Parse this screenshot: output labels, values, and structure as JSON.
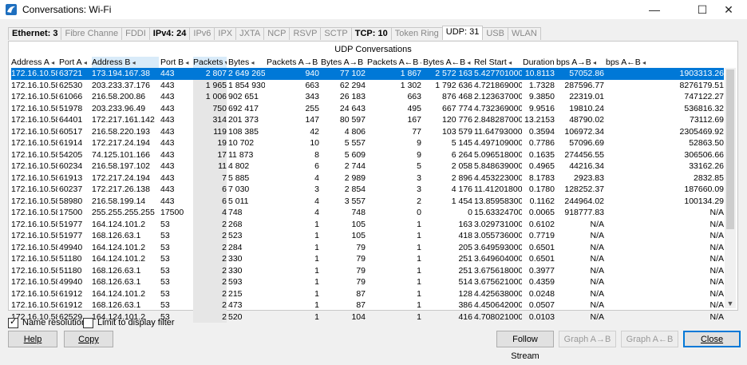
{
  "window": {
    "title": "Conversations: Wi-Fi",
    "minimize": "—",
    "maximize": "☐",
    "close": "✕"
  },
  "tabs": [
    {
      "label": "Ethernet: 3",
      "style": "bold"
    },
    {
      "label": "Fibre Channe",
      "style": "dim"
    },
    {
      "label": "FDDI",
      "style": "dim"
    },
    {
      "label": "IPv4: 24",
      "style": "bold"
    },
    {
      "label": "IPv6",
      "style": "dim"
    },
    {
      "label": "IPX",
      "style": "dim"
    },
    {
      "label": "JXTA",
      "style": "dim"
    },
    {
      "label": "NCP",
      "style": "dim"
    },
    {
      "label": "RSVP",
      "style": "dim"
    },
    {
      "label": "SCTP",
      "style": "dim"
    },
    {
      "label": "TCP: 10",
      "style": "bold"
    },
    {
      "label": "Token Ring",
      "style": "dim"
    },
    {
      "label": "UDP: 31",
      "style": "active"
    },
    {
      "label": "USB",
      "style": "dim"
    },
    {
      "label": "WLAN",
      "style": "dim"
    }
  ],
  "panel_title": "UDP Conversations",
  "columns": [
    "Address A",
    "Port A",
    "Address B",
    "Port B",
    "Packets",
    "Bytes",
    "Packets A→B",
    "Bytes A→B",
    "Packets A←B",
    "Bytes A←B",
    "Rel Start",
    "Duration",
    "bps A→B",
    "bps A←B"
  ],
  "sort_column": "Packets",
  "rows": [
    [
      "172.16.10.58",
      "63721",
      "173.194.167.38",
      "443",
      "2 807",
      "2 649 265",
      "940",
      "77 102",
      "1 867",
      "2 572 163",
      "5.427701000",
      "10.8113",
      "57052.86",
      "1903313.26"
    ],
    [
      "172.16.10.58",
      "62530",
      "203.233.37.176",
      "443",
      "1 965",
      "1 854 930",
      "663",
      "62 294",
      "1 302",
      "1 792 636",
      "4.721869000",
      "1.7328",
      "287596.77",
      "8276179.51"
    ],
    [
      "172.16.10.58",
      "61066",
      "216.58.200.86",
      "443",
      "1 006",
      "902 651",
      "343",
      "26 183",
      "663",
      "876 468",
      "2.123637000",
      "9.3850",
      "22319.01",
      "747122.27"
    ],
    [
      "172.16.10.58",
      "51978",
      "203.233.96.49",
      "443",
      "750",
      "692 417",
      "255",
      "24 643",
      "495",
      "667 774",
      "4.732369000",
      "9.9516",
      "19810.24",
      "536816.32"
    ],
    [
      "172.16.10.58",
      "64401",
      "172.217.161.142",
      "443",
      "314",
      "201 373",
      "147",
      "80 597",
      "167",
      "120 776",
      "2.848287000",
      "13.2153",
      "48790.02",
      "73112.69"
    ],
    [
      "172.16.10.58",
      "60517",
      "216.58.220.193",
      "443",
      "119",
      "108 385",
      "42",
      "4 806",
      "77",
      "103 579",
      "11.647930000",
      "0.3594",
      "106972.34",
      "2305469.92"
    ],
    [
      "172.16.10.58",
      "61914",
      "172.217.24.194",
      "443",
      "19",
      "10 702",
      "10",
      "5 557",
      "9",
      "5 145",
      "4.497109000",
      "0.7786",
      "57096.69",
      "52863.50"
    ],
    [
      "172.16.10.58",
      "54205",
      "74.125.101.166",
      "443",
      "17",
      "11 873",
      "8",
      "5 609",
      "9",
      "6 264",
      "5.096518000",
      "0.1635",
      "274456.55",
      "306506.66"
    ],
    [
      "172.16.10.58",
      "60234",
      "216.58.197.102",
      "443",
      "11",
      "4 802",
      "6",
      "2 744",
      "5",
      "2 058",
      "5.848639000",
      "0.4965",
      "44216.34",
      "33162.26"
    ],
    [
      "172.16.10.58",
      "61913",
      "172.217.24.194",
      "443",
      "7",
      "5 885",
      "4",
      "2 989",
      "3",
      "2 896",
      "4.453223000",
      "8.1783",
      "2923.83",
      "2832.85"
    ],
    [
      "172.16.10.58",
      "60237",
      "172.217.26.138",
      "443",
      "6",
      "7 030",
      "3",
      "2 854",
      "3",
      "4 176",
      "11.412018000",
      "0.1780",
      "128252.37",
      "187660.09"
    ],
    [
      "172.16.10.58",
      "58980",
      "216.58.199.14",
      "443",
      "6",
      "5 011",
      "4",
      "3 557",
      "2",
      "1 454",
      "13.859583000",
      "0.1162",
      "244964.02",
      "100134.29"
    ],
    [
      "172.16.10.58",
      "17500",
      "255.255.255.255",
      "17500",
      "4",
      "748",
      "4",
      "748",
      "0",
      "0",
      "15.633247000",
      "0.0065",
      "918777.83",
      "N/A"
    ],
    [
      "172.16.10.58",
      "51977",
      "164.124.101.2",
      "53",
      "2",
      "268",
      "1",
      "105",
      "1",
      "163",
      "3.029731000",
      "0.6102",
      "N/A",
      "N/A"
    ],
    [
      "172.16.10.58",
      "51977",
      "168.126.63.1",
      "53",
      "2",
      "523",
      "1",
      "105",
      "1",
      "418",
      "3.055736000",
      "0.7719",
      "N/A",
      "N/A"
    ],
    [
      "172.16.10.58",
      "49940",
      "164.124.101.2",
      "53",
      "2",
      "284",
      "1",
      "79",
      "1",
      "205",
      "3.649593000",
      "0.6501",
      "N/A",
      "N/A"
    ],
    [
      "172.16.10.58",
      "51180",
      "164.124.101.2",
      "53",
      "2",
      "330",
      "1",
      "79",
      "1",
      "251",
      "3.649604000",
      "0.6501",
      "N/A",
      "N/A"
    ],
    [
      "172.16.10.58",
      "51180",
      "168.126.63.1",
      "53",
      "2",
      "330",
      "1",
      "79",
      "1",
      "251",
      "3.675618000",
      "0.3977",
      "N/A",
      "N/A"
    ],
    [
      "172.16.10.58",
      "49940",
      "168.126.63.1",
      "53",
      "2",
      "593",
      "1",
      "79",
      "1",
      "514",
      "3.675621000",
      "0.4359",
      "N/A",
      "N/A"
    ],
    [
      "172.16.10.58",
      "61912",
      "164.124.101.2",
      "53",
      "2",
      "215",
      "1",
      "87",
      "1",
      "128",
      "4.425638000",
      "0.0248",
      "N/A",
      "N/A"
    ],
    [
      "172.16.10.58",
      "61912",
      "168.126.63.1",
      "53",
      "2",
      "473",
      "1",
      "87",
      "1",
      "386",
      "4.450642000",
      "0.0507",
      "N/A",
      "N/A"
    ],
    [
      "172.16.10.58",
      "62529",
      "164.124.101.2",
      "53",
      "2",
      "520",
      "1",
      "104",
      "1",
      "416",
      "4.708021000",
      "0.0103",
      "N/A",
      "N/A"
    ]
  ],
  "options": {
    "name_resolution": "Name resolution",
    "name_resolution_checked": true,
    "limit_filter": "Limit to display filter",
    "limit_filter_checked": false
  },
  "buttons": {
    "help": "Help",
    "copy": "Copy",
    "follow_stream": "Follow Stream",
    "graph_ab": "Graph A→B",
    "graph_ba": "Graph A←B",
    "close": "Close"
  },
  "colors": {
    "selection": "#0078d7",
    "sort_header": "#d9ebf9",
    "shaded_column": "#e6e6e6"
  }
}
